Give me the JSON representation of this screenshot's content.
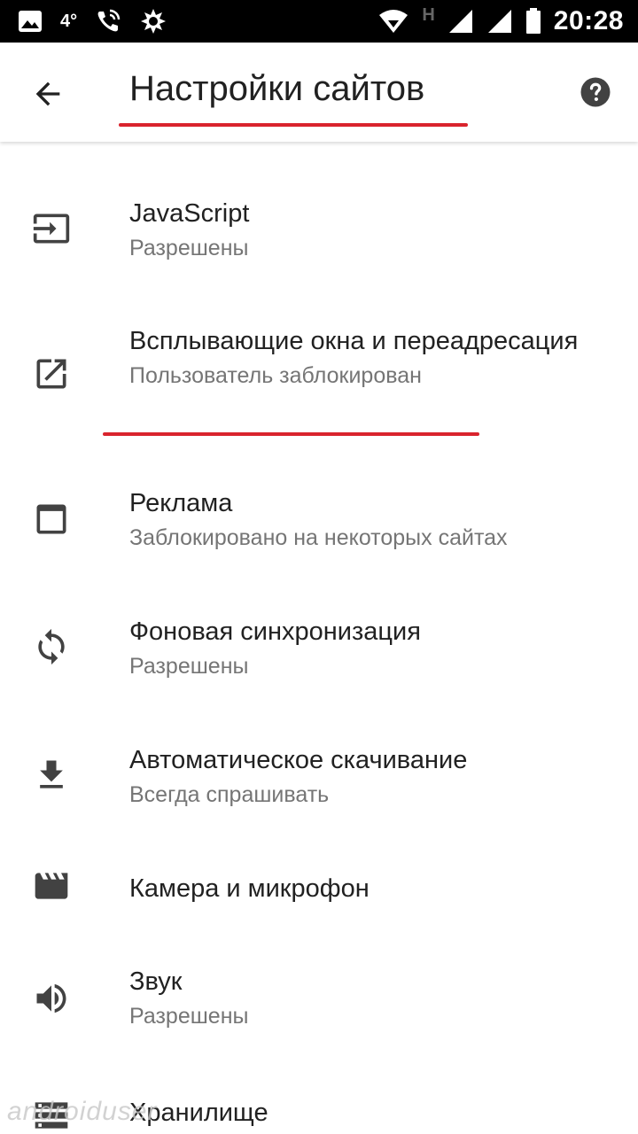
{
  "status_bar": {
    "temperature": "4°",
    "network_letter": "H",
    "time": "20:28"
  },
  "app_bar": {
    "title": "Настройки сайтов",
    "back_icon": "arrow-back-icon",
    "help_icon": "help-icon"
  },
  "settings": [
    {
      "title": "JavaScript",
      "subtitle": "Разрешены",
      "icon": "javascript-icon"
    },
    {
      "title": "Всплывающие окна и переадресация",
      "subtitle": "Пользователь заблокирован",
      "icon": "open-in-new-icon"
    },
    {
      "title": "Реклама",
      "subtitle": "Заблокировано на некоторых сайтах",
      "icon": "window-icon"
    },
    {
      "title": "Фоновая синхронизация",
      "subtitle": "Разрешены",
      "icon": "sync-icon"
    },
    {
      "title": "Автоматическое скачивание",
      "subtitle": "Всегда спрашивать",
      "icon": "download-icon"
    },
    {
      "title": "Камера и микрофон",
      "subtitle": "",
      "icon": "camera-clapper-icon"
    },
    {
      "title": "Звук",
      "subtitle": "Разрешены",
      "icon": "volume-icon"
    },
    {
      "title": "Хранилище",
      "subtitle": "",
      "icon": "storage-icon"
    }
  ],
  "watermark": "androiduser",
  "colors": {
    "highlight": "#d9232d",
    "primary_text": "#212121",
    "secondary_text": "#757575",
    "icon": "#424242"
  }
}
